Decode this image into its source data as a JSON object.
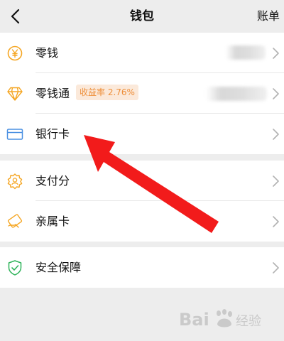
{
  "header": {
    "title": "钱包",
    "bill_label": "账单"
  },
  "groups": {
    "balance": {
      "items": [
        {
          "label": "零钱",
          "icon": "yuan-coin-icon"
        },
        {
          "label": "零钱通",
          "icon": "diamond-icon",
          "badge": "收益率 2.76%"
        },
        {
          "label": "银行卡",
          "icon": "bank-card-icon"
        }
      ]
    },
    "credit": {
      "items": [
        {
          "label": "支付分",
          "icon": "pay-score-icon"
        },
        {
          "label": "亲属卡",
          "icon": "family-card-icon"
        }
      ]
    },
    "security": {
      "items": [
        {
          "label": "安全保障",
          "icon": "shield-check-icon"
        }
      ]
    }
  },
  "colors": {
    "accent_orange": "#f5a623",
    "badge_text": "#ee8f3a",
    "badge_bg": "#fbe9da",
    "card_blue": "#4a90e2",
    "shield_green": "#2fb35a",
    "arrow_red": "#f21b1b"
  }
}
